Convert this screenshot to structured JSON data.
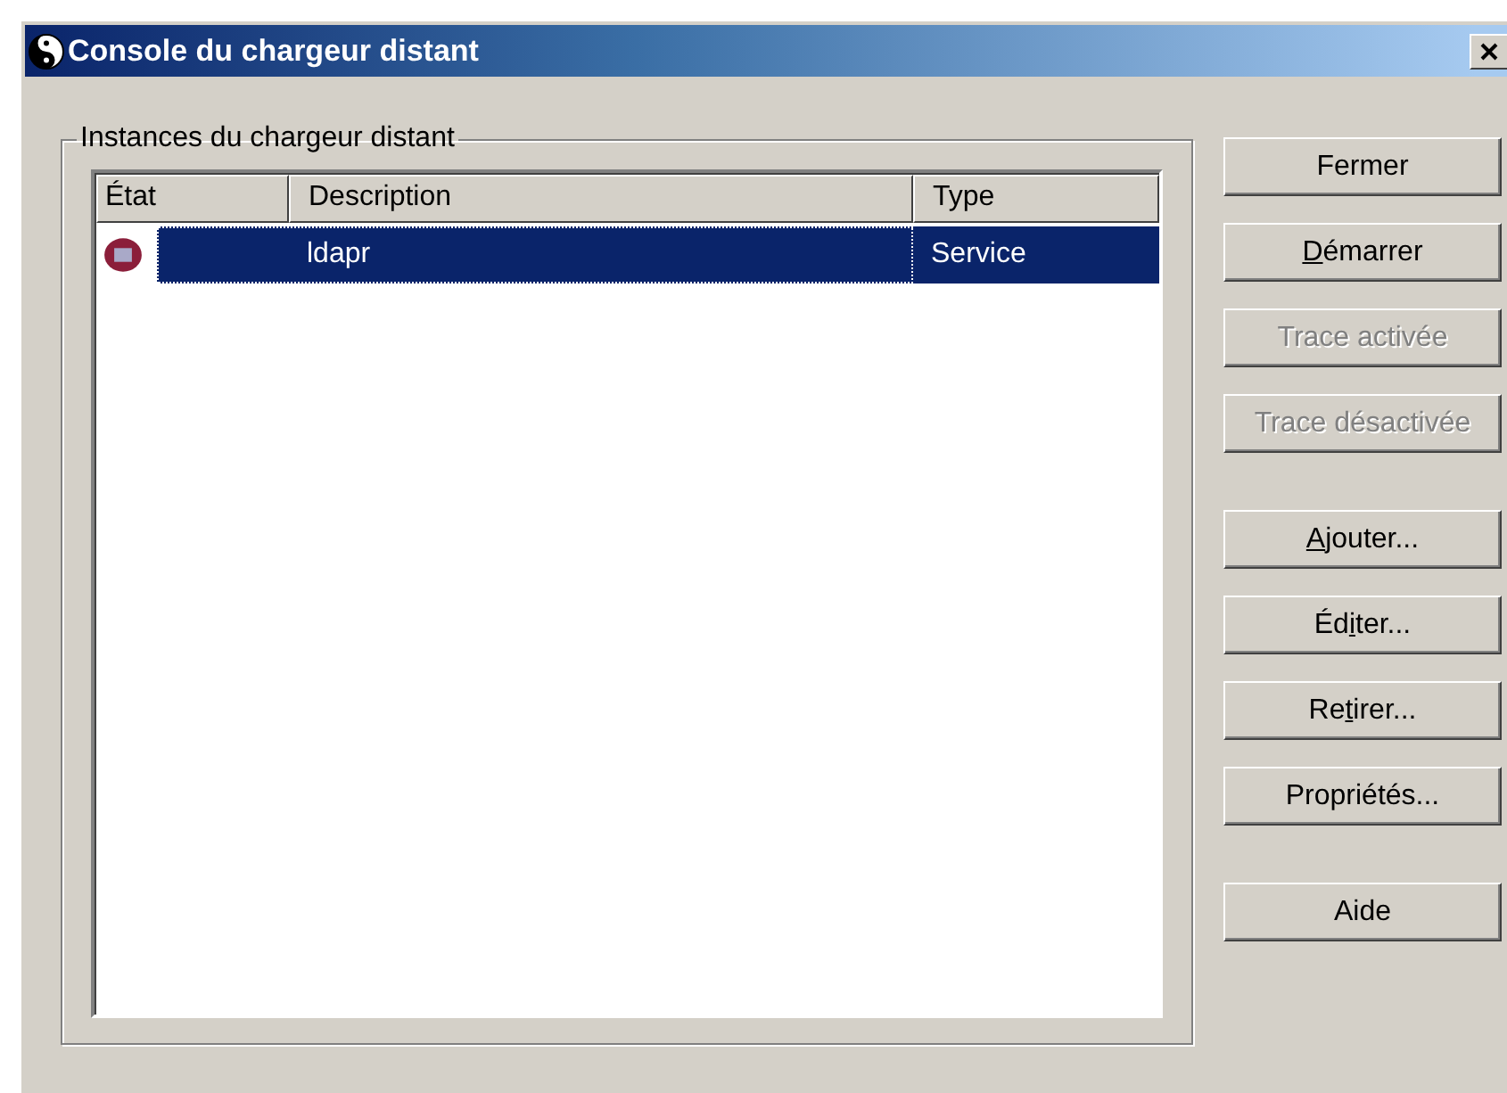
{
  "window": {
    "title": "Console du chargeur distant"
  },
  "group": {
    "label": "Instances du chargeur distant"
  },
  "table": {
    "columns": [
      "État",
      "Description",
      "Type"
    ],
    "rows": [
      {
        "description": "ldapr",
        "type": "Service",
        "selected": true
      }
    ]
  },
  "button_groups": [
    [
      {
        "label": "Fermer",
        "disabled": false
      },
      {
        "mnemonic": "D",
        "after": "émarrer",
        "disabled": false
      },
      {
        "label": "Trace activée",
        "disabled": true
      },
      {
        "label": "Trace désactivée",
        "disabled": true
      }
    ],
    [
      {
        "mnemonic": "A",
        "after": "jouter...",
        "disabled": false
      },
      {
        "label": "Éd",
        "mnemonic": "i",
        "after": "ter...",
        "disabled": false
      },
      {
        "label": "Re",
        "mnemonic": "t",
        "after": "irer...",
        "disabled": false
      },
      {
        "label": "Propriétés...",
        "disabled": false
      }
    ],
    [
      {
        "label": "Aide",
        "disabled": false
      }
    ]
  ]
}
